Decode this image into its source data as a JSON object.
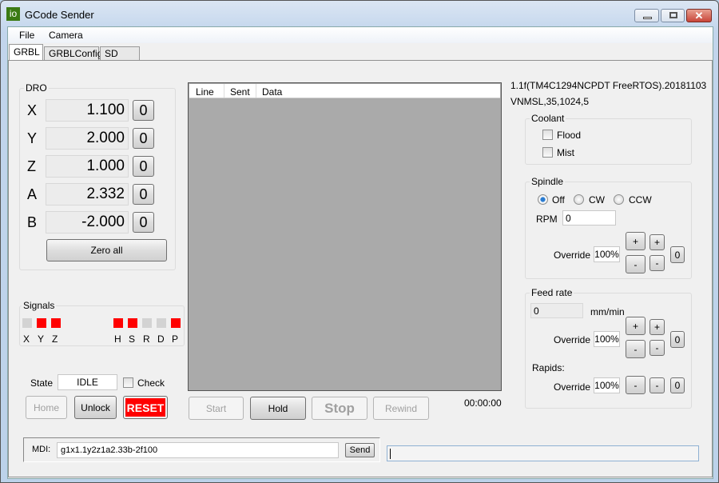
{
  "window": {
    "title": "GCode Sender",
    "icon_text": "io",
    "buttons": [
      "minimize",
      "maximize",
      "close"
    ]
  },
  "menu": [
    "File",
    "Camera"
  ],
  "tabs": [
    {
      "label": "GRBL",
      "active": true
    },
    {
      "label": "GRBLConfig"
    },
    {
      "label": "SD Card"
    }
  ],
  "dro": {
    "title": "DRO",
    "axes": [
      {
        "label": "X",
        "value": "1.100"
      },
      {
        "label": "Y",
        "value": "2.000"
      },
      {
        "label": "Z",
        "value": "1.000"
      },
      {
        "label": "A",
        "value": "2.332"
      },
      {
        "label": "B",
        "value": "-2.000"
      }
    ],
    "zero_label": "0",
    "zero_all": "Zero all"
  },
  "signals": {
    "title": "Signals",
    "items": [
      {
        "label": "X",
        "active": false
      },
      {
        "label": "Y",
        "active": true
      },
      {
        "label": "Z",
        "active": true
      },
      {
        "label": "H",
        "active": true
      },
      {
        "label": "S",
        "active": true
      },
      {
        "label": "R",
        "active": false
      },
      {
        "label": "D",
        "active": false
      },
      {
        "label": "P",
        "active": true
      }
    ],
    "colors": {
      "on": "#ff0000",
      "off": "#d3d3d3"
    }
  },
  "state": {
    "label": "State",
    "value": "IDLE",
    "check_label": "Check",
    "check_checked": false
  },
  "buttons": {
    "home": "Home",
    "unlock": "Unlock",
    "reset": "RESET",
    "start": "Start",
    "hold": "Hold",
    "stop": "Stop",
    "rewind": "Rewind"
  },
  "grid": {
    "columns": [
      "Line",
      "Sent",
      "Data"
    ],
    "rows": []
  },
  "elapsed": "00:00:00",
  "version": {
    "line1": "1.1f(TM4C1294NCPDT FreeRTOS).20181103",
    "line2": "VNMSL,35,1024,5"
  },
  "coolant": {
    "title": "Coolant",
    "flood": "Flood",
    "mist": "Mist",
    "flood_checked": false,
    "mist_checked": false
  },
  "spindle": {
    "title": "Spindle",
    "options": [
      "Off",
      "CW",
      "CCW"
    ],
    "selected": "Off",
    "rpm_label": "RPM",
    "rpm": "0",
    "override_label": "Override",
    "override": "100%"
  },
  "feed": {
    "title": "Feed rate",
    "value": "0",
    "unit": "mm/min",
    "override_label": "Override",
    "override": "100%",
    "rapids_label": "Rapids:",
    "rapids_override_label": "Override",
    "rapids_override": "100%"
  },
  "ovr": {
    "plus": "+",
    "minus": "-",
    "reset": "0"
  },
  "mdi": {
    "label": "MDI:",
    "value": "g1x1.1y2z1a2.33b-2f100",
    "send": "Send"
  },
  "status": {
    "value": ""
  }
}
